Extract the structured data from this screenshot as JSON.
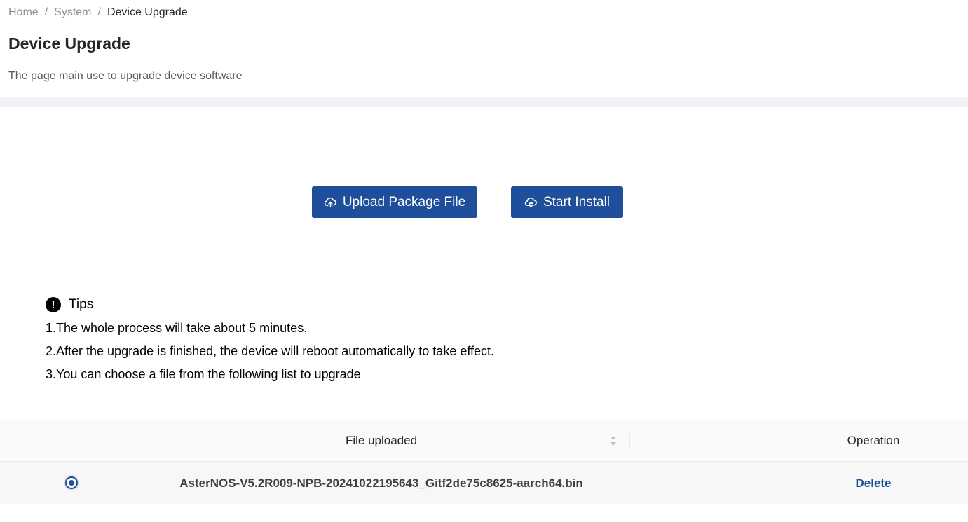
{
  "breadcrumb": [
    {
      "label": "Home"
    },
    {
      "label": "System"
    },
    {
      "label": "Device Upgrade"
    }
  ],
  "breadcrumb_separator": "/",
  "page": {
    "title": "Device Upgrade",
    "description": "The page main use to upgrade device software"
  },
  "actions": {
    "upload_label": "Upload Package File",
    "upload_icon": "cloud-upload-icon",
    "install_label": "Start Install",
    "install_icon": "cloud-sync-icon"
  },
  "tips": {
    "icon": "exclamation-circle-icon",
    "icon_glyph": "!",
    "title": "Tips",
    "lines": [
      "1.The whole process will take about 5 minutes.",
      "2.After the upgrade is finished, the device will reboot automatically to take effect.",
      "3.You can choose a file from the following list to upgrade"
    ]
  },
  "table": {
    "columns": {
      "file": "File uploaded",
      "operation": "Operation"
    },
    "rows": [
      {
        "selected": true,
        "file": "AsterNOS-V5.2R009-NPB-20241022195643_Gitf2de75c8625-aarch64.bin",
        "operation": "Delete"
      }
    ]
  },
  "colors": {
    "primary": "#1f4f9a",
    "band": "#f0f2f5"
  }
}
